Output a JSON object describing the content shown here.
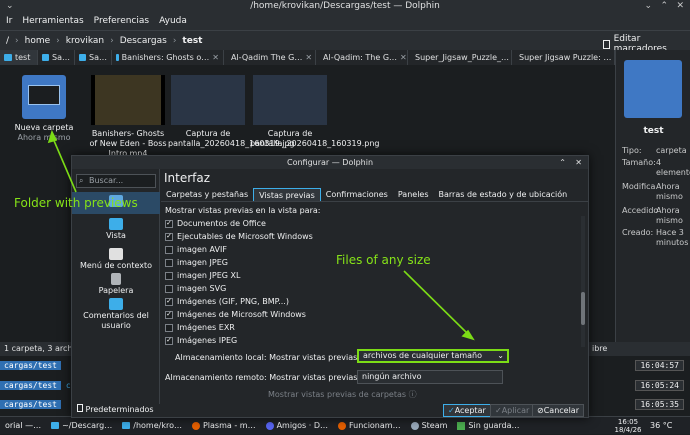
{
  "window": {
    "title": "/home/krovikan/Descargas/test — Dolphin"
  },
  "menu": [
    "Ir",
    "Herramientas",
    "Preferencias",
    "Ayuda"
  ],
  "breadcrumb": [
    "/",
    "home",
    "krovikan",
    "Descargas",
    "test"
  ],
  "toolbar": {
    "edit_bookmarks": "Editar marcadores"
  },
  "tabs": [
    {
      "label": "test",
      "active": true
    },
    {
      "label": "Sa…"
    },
    {
      "label": "Sa…"
    },
    {
      "label": "Banishers: Ghosts o…"
    },
    {
      "label": "Al-Qadim The G…"
    },
    {
      "label": "Al-Qadim: The G…"
    },
    {
      "label": "Super_Jigsaw_Puzzle_…"
    },
    {
      "label": "Super Jigsaw Puzzle: …"
    }
  ],
  "files": [
    {
      "name": "Nueva carpeta",
      "sub": "Ahora mismo"
    },
    {
      "name": "Banishers- Ghosts of New Eden - Boss Intro.mp4"
    },
    {
      "name": "Captura de pantalla_20260418_160319.jpg"
    },
    {
      "name": "Captura de pantalla_20260418_160319.png"
    }
  ],
  "info_panel": {
    "name": "test",
    "rows": [
      {
        "k": "Tipo:",
        "v": "carpeta"
      },
      {
        "k": "Tamaño:",
        "v": "4 elementos"
      },
      {
        "k": "Modifica",
        "v": "Ahora mismo"
      },
      {
        "k": "Accedido",
        "v": "Ahora mismo"
      },
      {
        "k": "Creado:",
        "v": "Hace 3 minutos"
      }
    ]
  },
  "statusbar": {
    "text": "1 carpeta, 3 archivo",
    "right": "ibre"
  },
  "terminal": {
    "lines": [
      {
        "path": "cargas/test",
        "cmd": "",
        "time": "16:04:57"
      },
      {
        "path": "cargas/test",
        "cmd": "cd /h",
        "time": "16:05:24"
      },
      {
        "path": "cargas/test",
        "cmd": "",
        "time": "16:05:35"
      }
    ]
  },
  "taskbar": {
    "items": [
      "orial —…",
      "~/Descarg…",
      "/home/kro…",
      "Plasma - m…",
      "Amigos · D…",
      "Funcionam…",
      "Steam",
      "Sin guarda…"
    ],
    "clock": "16:05",
    "date": "18/4/26",
    "temp": "36 °C"
  },
  "dialog": {
    "title": "Configurar — Dolphin",
    "search_placeholder": "Buscar...",
    "sidebar": [
      {
        "label": "Interfaz",
        "selected": true
      },
      {
        "label": "Vista"
      },
      {
        "label": "Menú de contexto"
      },
      {
        "label": "Papelera"
      },
      {
        "label": "Comentarios del usuario"
      }
    ],
    "heading": "Interfaz",
    "tabs": [
      "Carpetas y pestañas",
      "Vistas previas",
      "Confirmaciones",
      "Paneles",
      "Barras de estado y de ubicación"
    ],
    "active_tab": 1,
    "section_label": "Mostrar vistas previas en la vista para:",
    "items": [
      {
        "label": "Documentos de Office",
        "checked": true
      },
      {
        "label": "Ejecutables de Microsoft Windows",
        "checked": true
      },
      {
        "label": "imagen AVIF",
        "checked": false
      },
      {
        "label": "imagen JPEG",
        "checked": false
      },
      {
        "label": "imagen JPEG XL",
        "checked": false
      },
      {
        "label": "imagen SVG",
        "checked": false
      },
      {
        "label": "Imágenes (GIF, PNG, BMP...)",
        "checked": true
      },
      {
        "label": "Imágenes de Microsoft Windows",
        "checked": true
      },
      {
        "label": "Imágenes EXR",
        "checked": false
      },
      {
        "label": "Imágenes IPEG",
        "checked": true
      }
    ],
    "local_label": "Almacenamiento local: Mostrar vistas previas para",
    "local_value": "archivos de cualquier tamaño",
    "remote_label": "Almacenamiento remoto: Mostrar vistas previas para",
    "remote_value": "ningún archivo",
    "disabled_label": "Mostrar vistas previas de carpetas",
    "buttons": {
      "defaults": "Predeterminados",
      "accept": "Aceptar",
      "apply": "Aplicar",
      "cancel": "Cancelar"
    }
  },
  "annotations": {
    "folder": "Folder with previews",
    "files": "Files of any size",
    "color": "#7cdc16"
  }
}
